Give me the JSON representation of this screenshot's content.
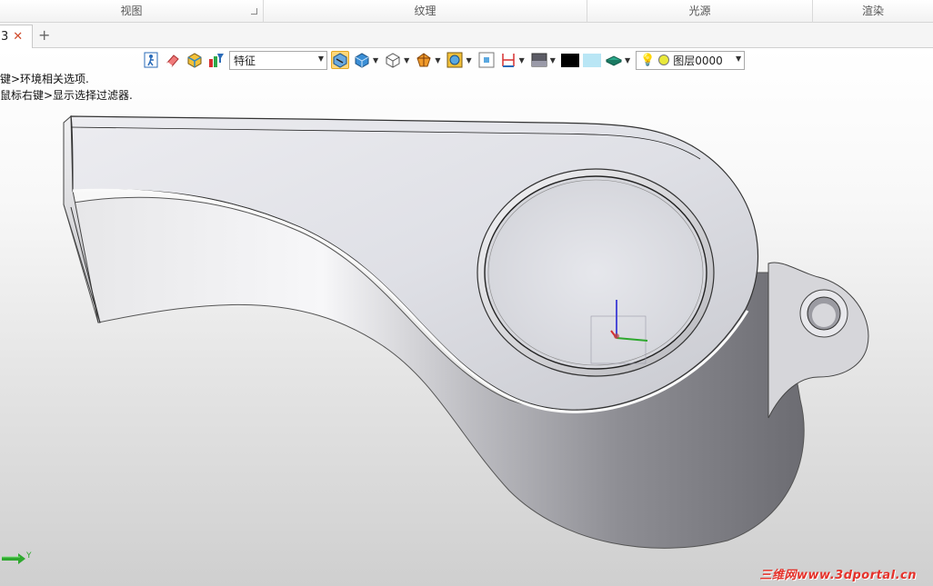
{
  "ribbon": {
    "groups": [
      "视图",
      "纹理",
      "光源",
      "渲染"
    ]
  },
  "tabs": {
    "active_label": "3",
    "close_glyph": "✕",
    "add_glyph": "+"
  },
  "toolbar": {
    "selection_filter": "特征",
    "layer_name": "图层0000",
    "color_swatches": [
      "#000000",
      "#b9e6f5"
    ],
    "icons": [
      "walk-icon",
      "eraser-icon",
      "box-display-icon",
      "filter-icon",
      "select-mode-icon",
      "shaded-cube-icon",
      "wireframe-cube-icon",
      "section-icon",
      "view-orient-icon",
      "zoom-fit-icon",
      "dimension-icon",
      "background-icon",
      "layer-plane-icon",
      "bulb-icon"
    ]
  },
  "messages": {
    "line1": "键>环境相关选项.",
    "line2": "鼠标右键>显示选择过滤器."
  },
  "triad": {
    "axis_label": "Y"
  },
  "watermark": {
    "text": "三维网www.3dportal.cn"
  },
  "colors": {
    "accent": "#ffd77a",
    "close": "#d04a2a",
    "watermark": "#e5322b"
  }
}
